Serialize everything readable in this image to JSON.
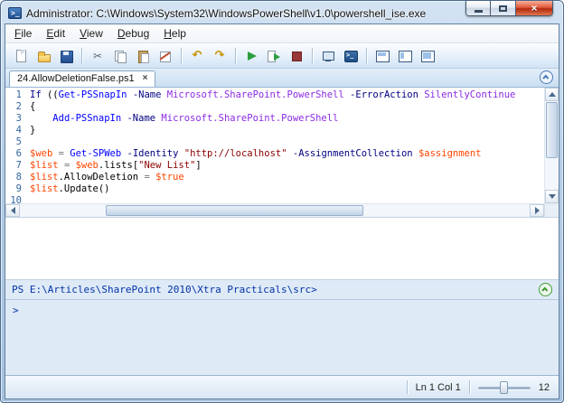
{
  "window": {
    "title": "Administrator: C:\\Windows\\System32\\WindowsPowerShell\\v1.0\\powershell_ise.exe"
  },
  "menubar": {
    "items": [
      "File",
      "Edit",
      "View",
      "Debug",
      "Help"
    ]
  },
  "toolbar": {
    "buttons": [
      "new-script",
      "open-script",
      "save-script",
      "sep",
      "cut",
      "copy",
      "paste",
      "clear-output",
      "sep",
      "undo",
      "redo",
      "sep",
      "run-script",
      "run-selection",
      "stop-execution",
      "sep",
      "new-remote-powershell-tab",
      "start-powershell",
      "sep",
      "layout-script-top",
      "layout-script-right",
      "layout-script-maximized"
    ]
  },
  "tabs": {
    "active": {
      "title": "24.AllowDeletionFalse.ps1",
      "close_glyph": "×"
    }
  },
  "editor": {
    "syntax_colors": {
      "kw": "#00008B",
      "cmd": "#0000FF",
      "prm": "#000080",
      "arg": "#8A2BE2",
      "str": "#8B0000",
      "var": "#FF4500",
      "op": "#757575",
      "pln": "#000000"
    },
    "lines": [
      {
        "n": 1,
        "tokens": [
          [
            "If",
            "kw"
          ],
          [
            " ((",
            "pln"
          ],
          [
            "Get-PSSnapIn",
            "cmd"
          ],
          [
            " ",
            "pln"
          ],
          [
            "-Name",
            "prm"
          ],
          [
            " ",
            "pln"
          ],
          [
            "Microsoft.SharePoint.PowerShell",
            "arg"
          ],
          [
            " ",
            "pln"
          ],
          [
            "-ErrorAction",
            "prm"
          ],
          [
            " ",
            "pln"
          ],
          [
            "SilentlyContinue",
            "arg"
          ]
        ]
      },
      {
        "n": 2,
        "tokens": [
          [
            "{",
            "pln"
          ]
        ]
      },
      {
        "n": 3,
        "tokens": [
          [
            "    ",
            "pln"
          ],
          [
            "Add-PSSnapIn",
            "cmd"
          ],
          [
            " ",
            "pln"
          ],
          [
            "-Name",
            "prm"
          ],
          [
            " ",
            "pln"
          ],
          [
            "Microsoft.SharePoint.PowerShell",
            "arg"
          ]
        ]
      },
      {
        "n": 4,
        "tokens": [
          [
            "}",
            "pln"
          ]
        ]
      },
      {
        "n": 5,
        "tokens": []
      },
      {
        "n": 6,
        "tokens": [
          [
            "$web",
            "var"
          ],
          [
            " ",
            "pln"
          ],
          [
            "=",
            "op"
          ],
          [
            " ",
            "pln"
          ],
          [
            "Get-SPWeb",
            "cmd"
          ],
          [
            " ",
            "pln"
          ],
          [
            "-Identity",
            "prm"
          ],
          [
            " ",
            "pln"
          ],
          [
            "\"http://localhost\"",
            "str"
          ],
          [
            " ",
            "pln"
          ],
          [
            "-AssignmentCollection",
            "prm"
          ],
          [
            " ",
            "pln"
          ],
          [
            "$assignment",
            "var"
          ]
        ]
      },
      {
        "n": 7,
        "tokens": [
          [
            "$list",
            "var"
          ],
          [
            " ",
            "pln"
          ],
          [
            "=",
            "op"
          ],
          [
            " ",
            "pln"
          ],
          [
            "$web",
            "var"
          ],
          [
            ".lists[",
            "pln"
          ],
          [
            "\"New List\"",
            "str"
          ],
          [
            "]",
            "pln"
          ]
        ]
      },
      {
        "n": 8,
        "tokens": [
          [
            "$list",
            "var"
          ],
          [
            ".AllowDeletion ",
            "pln"
          ],
          [
            "=",
            "op"
          ],
          [
            " ",
            "pln"
          ],
          [
            "$true",
            "var"
          ]
        ]
      },
      {
        "n": 9,
        "tokens": [
          [
            "$list",
            "var"
          ],
          [
            ".Update()",
            "pln"
          ]
        ]
      },
      {
        "n": 10,
        "tokens": []
      }
    ]
  },
  "console": {
    "prompt": "PS E:\\Articles\\SharePoint 2010\\Xtra Practicals\\src>",
    "input_prompt": ">"
  },
  "statusbar": {
    "position": "Ln 1 Col 1",
    "zoom": "12"
  }
}
